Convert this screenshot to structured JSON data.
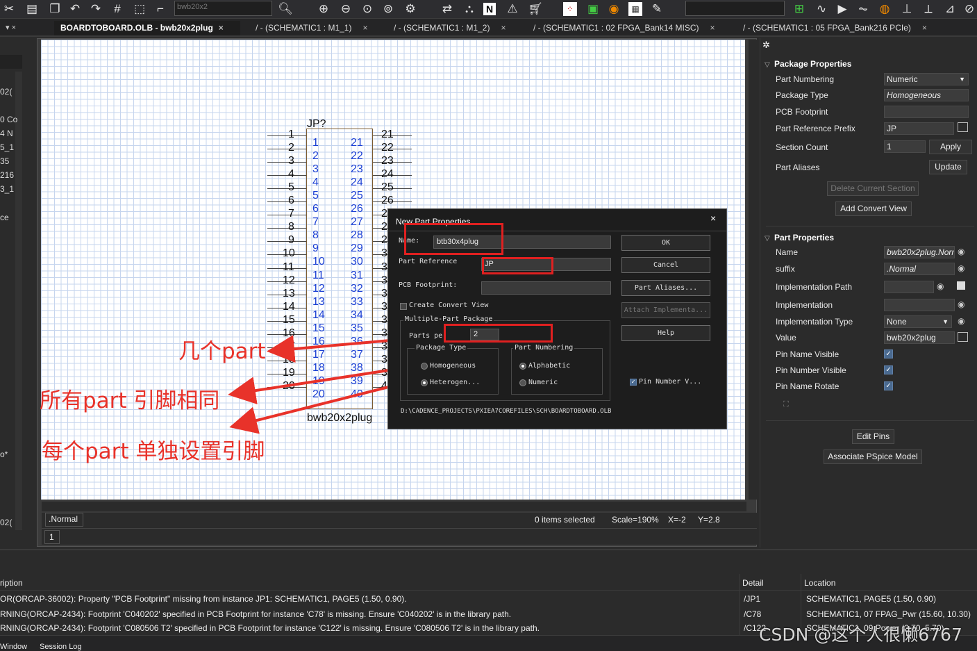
{
  "toolbar": {
    "part_combo": "bwb20x2",
    "icons": [
      "scissors-icon",
      "clipboard-icon",
      "copy-icon",
      "undo-icon",
      "redo-icon",
      "grid-icon",
      "select-icon",
      "wire-icon",
      "zoom-in-icon",
      "zoom-out-icon",
      "zoom-fit-icon",
      "zoom-area-icon",
      "part-icon",
      "pin-icon",
      "net-icon",
      "bom-icon"
    ]
  },
  "tabs": [
    {
      "label": "BOARDTOBOARD.OLB - bwb20x2plug"
    },
    {
      "label": "/ - (SCHEMATIC1 : M1_1)"
    },
    {
      "label": "/ - (SCHEMATIC1 : M1_2)"
    },
    {
      "label": "/ - (SCHEMATIC1 : 02 FPGA_Bank14 MISC)"
    },
    {
      "label": "/ - (SCHEMATIC1 : 05 FPGA_Bank216 PCIe)"
    }
  ],
  "left_panel": {
    "fragments": [
      "02(",
      "0 Co",
      "4 N",
      "5_1",
      "35",
      "216",
      "3_1",
      "ce",
      "o*",
      "02("
    ]
  },
  "schematic": {
    "ref": "JP?",
    "value": "bwb20x2plug",
    "left_pin_numbers": [
      "1",
      "2",
      "3",
      "4",
      "5",
      "6",
      "7",
      "8",
      "9",
      "10",
      "11",
      "12",
      "13",
      "14",
      "15",
      "16",
      "17",
      "18",
      "19",
      "20"
    ],
    "left_pin_names": [
      "1",
      "2",
      "3",
      "4",
      "5",
      "6",
      "7",
      "8",
      "9",
      "10",
      "11",
      "12",
      "13",
      "14",
      "15",
      "16",
      "17",
      "18",
      "19",
      "20"
    ],
    "right_pin_names": [
      "21",
      "22",
      "23",
      "24",
      "25",
      "26",
      "27",
      "28",
      "29",
      "30",
      "31",
      "32",
      "33",
      "34",
      "35",
      "36",
      "37",
      "38",
      "39",
      "40"
    ],
    "right_pin_numbers": [
      "21",
      "22",
      "23",
      "24",
      "25",
      "26",
      "2",
      "2",
      "2",
      "3",
      "3",
      "3",
      "3",
      "3",
      "3",
      "3",
      "3",
      "3",
      "3",
      "4"
    ]
  },
  "annotations": {
    "parts_count": "几个part",
    "homogeneous": "所有part 引脚相同",
    "heterogeneous": "每个part 单独设置引脚"
  },
  "dialog": {
    "title": "New Part Properties",
    "close": "×",
    "name_label": "Name:",
    "name_value": "btb30x4plug",
    "part_reference_label": "Part Reference",
    "part_reference_value": "JP",
    "pcb_footprint_label": "PCB Footprint:",
    "pcb_footprint_value": "",
    "create_convert_view": "Create Convert View",
    "multiple_part_package": "Multiple-Part Package",
    "parts_per_pkg_label": "Parts pe",
    "parts_per_pkg_value": "2",
    "package_type_label": "Package Type",
    "homogeneous": "Homogeneous",
    "heterogeneous": "Heterogen...",
    "part_numbering_label": "Part Numbering",
    "alphabetic": "Alphabetic",
    "numeric": "Numeric",
    "pin_number_visible": "Pin Number V...",
    "ok": "OK",
    "cancel": "Cancel",
    "part_aliases": "Part Aliases...",
    "attach_implementation": "Attach Implementa...",
    "help": "Help",
    "path": "D:\\CADENCE_PROJECTS\\PXIEA7COREFILES\\SCH\\BOARDTOBOARD.OLB"
  },
  "status": {
    "section": ".Normal",
    "page": "1",
    "selected": "0 items selected",
    "scale": "Scale=190%",
    "x": "X=-2",
    "y": "Y=2.8"
  },
  "right_panel": {
    "package_header": "Package Properties",
    "part_numbering_label": "Part Numbering",
    "part_numbering_value": "Numeric",
    "package_type_label": "Package Type",
    "package_type_value": "Homogeneous",
    "pcb_footprint_label": "PCB Footprint",
    "pcb_footprint_value": "",
    "ref_prefix_label": "Part Reference Prefix",
    "ref_prefix_value": "JP",
    "section_count_label": "Section Count",
    "section_count_value": "1",
    "apply": "Apply",
    "part_aliases_label": "Part Aliases",
    "update": "Update",
    "delete_section": "Delete Current Section",
    "add_convert_view": "Add Convert View",
    "part_header": "Part Properties",
    "name_label": "Name",
    "name_value": "bwb20x2plug.Norm",
    "suffix_label": "suffix",
    "suffix_value": ".Normal",
    "impl_path_label": "Implementation Path",
    "impl_path_value": "",
    "impl_label": "Implementation",
    "impl_value": "",
    "impl_type_label": "Implementation Type",
    "impl_type_value": "None",
    "value_label": "Value",
    "value_value": "bwb20x2plug",
    "pin_name_visible_label": "Pin Name Visible",
    "pin_number_visible_label": "Pin Number Visible",
    "pin_name_rotate_label": "Pin Name Rotate",
    "edit_pins": "Edit Pins",
    "associate_pspice": "Associate PSpice Model"
  },
  "log": {
    "headers": {
      "description": "ription",
      "detail": "Detail",
      "location": "Location"
    },
    "rows": [
      {
        "description": "OR(ORCAP-36002): Property \"PCB Footprint\" missing from instance JP1: SCHEMATIC1, PAGE5 (1.50, 0.90).",
        "detail": "/JP1",
        "location": "SCHEMATIC1, PAGE5  (1.50, 0.90)"
      },
      {
        "description": "RNING(ORCAP-2434): Footprint 'C040202' specified in PCB Footprint for instance 'C78' is missing. Ensure 'C040202' is in the library path.",
        "detail": "/C78",
        "location": "SCHEMATIC1, 07 FPAG_Pwr  (15.60, 10.30)"
      },
      {
        "description": "RNING(ORCAP-2434): Footprint 'C080506 T2' specified in PCB Footprint for instance 'C122' is missing. Ensure 'C080506 T2' is in the library path.",
        "detail": "/C122",
        "location": "SCHEMATIC1, 09 Power  (2.70, 5.70)"
      }
    ],
    "tabs": [
      "Window",
      "Session Log"
    ]
  },
  "watermark": "CSDN @这个人很懒6767"
}
